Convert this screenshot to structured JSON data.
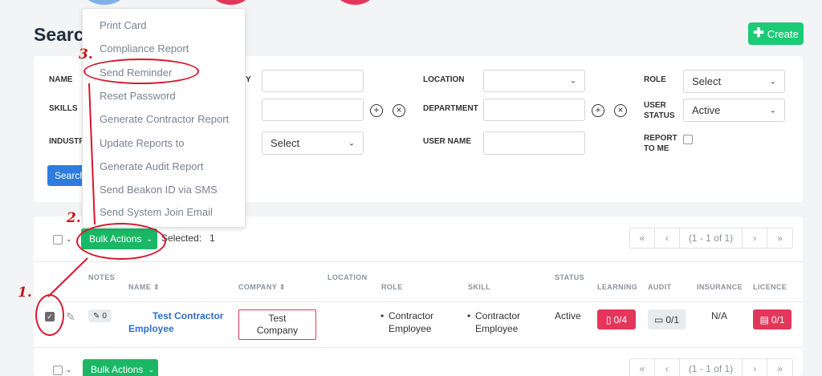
{
  "page": {
    "title": "Searcl",
    "create_label": "Create"
  },
  "filters": {
    "name_label": "NAME",
    "skills_label": "SKILLS",
    "industry_label": "INDUSTR",
    "partial_label": "Y",
    "location_label": "LOCATION",
    "department_label": "DEPARTMENT",
    "user_name_label": "USER NAME",
    "role_label": "ROLE",
    "user_status_label": "USER STATUS",
    "report_to_me_label": "REPORT TO ME",
    "role_value": "Select",
    "user_status_value": "Active",
    "industry_select_value": "Select",
    "search_label": "Search"
  },
  "bulk_menu": {
    "items": [
      "Print Card",
      "Compliance Report",
      "Send Reminder",
      "Reset Password",
      "Generate Contractor Report",
      "Update Reports to",
      "Generate Audit Report",
      "Send Beakon ID via SMS",
      "Send System Join Email"
    ]
  },
  "toolbar": {
    "bulk_actions_label": "Bulk Actions",
    "selected_label": "Selected:",
    "selected_count": "1",
    "pager": {
      "first": "«",
      "prev": "‹",
      "info": "(1 - 1 of 1)",
      "next": "›",
      "last": "»"
    }
  },
  "table": {
    "headers": {
      "notes": "NOTES",
      "name": "NAME ⇕",
      "company": "COMPANY ⇕",
      "location": "LOCATION",
      "role": "ROLE",
      "skill": "SKILL",
      "status": "STATUS",
      "learning": "LEARNING",
      "audit": "AUDIT",
      "insurance": "INSURANCE",
      "licence": "LICENCE"
    },
    "row": {
      "notes_count": "0",
      "name_line1": "Test Contractor",
      "name_line2": "Employee",
      "company_line1": "Test",
      "company_line2": "Company",
      "role_line1": "Contractor",
      "role_line2": "Employee",
      "skill_line1": "Contractor",
      "skill_line2": "Employee",
      "status": "Active",
      "learning": "0/4",
      "audit": "0/1",
      "insurance": "N/A",
      "licence": "0/1"
    }
  },
  "annotations": {
    "step1": "1.",
    "step2": "2.",
    "step3": "3."
  },
  "colors": {
    "accent_green": "#1ccb76",
    "danger": "#e4365a",
    "primary": "#2f7ce0",
    "annotation": "#d6182e"
  }
}
